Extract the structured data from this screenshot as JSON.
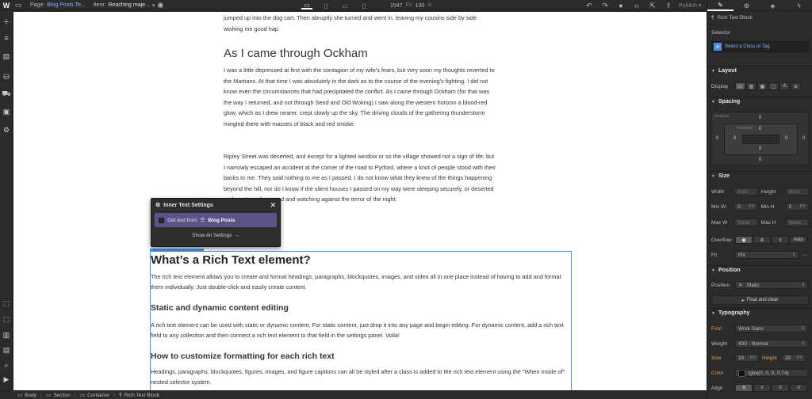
{
  "topbar": {
    "logo": "W",
    "page_label": "Page:",
    "page_value": "Blog Posts Te...",
    "item_label": "Item:",
    "item_value": "Reaching maje...",
    "canvas_width": "1547",
    "width_unit": "PX",
    "zoom": "100",
    "zoom_unit": "%",
    "publish_label": "Publish"
  },
  "article": {
    "p1": "jumped up into the dog cart.  Then abruptly she turned and went in, leaving my cousins side by side wishing me good hap.",
    "heading": "As I came through Ockham",
    "p2": "I was a little depressed at first with the contagion of my wife's fears, but very soon my thoughts reverted to the Martians.  At that time I was absolutely in the dark as to the course of the evening's fighting.  I did not know even the circumstances that had precipitated the conflict.  As I came through Ockham (for that was the way I returned, and not through Send and Old Woking) I saw along the western horizon a blood-red glow, which as I drew nearer, crept slowly up the sky.  The driving clouds of the gathering thunderstorm mingled there with masses of black and red smoke.",
    "p3": "Ripley Street was deserted, and except for a lighted window or so the village showed not a sign of life; but I narrowly escaped an accident at the corner of the road to Pyrford, where a knot of people stood with their backs to me.  They said nothing to me as I passed.  I do not know what they knew of the things happening beyond the hill, nor do I know if the silent houses I passed on my way were sleeping securely, or deserted and empty, or harassed and watching against the terror of the night."
  },
  "rich_text": {
    "h1": "What’s a Rich Text element?",
    "p1": "The rich text element allows you to create and format headings, paragraphs, blockquotes, images, and video all in one place instead of having to add and format them individually. Just double-click and easily create content.",
    "h2": "Static and dynamic content editing",
    "p2": "A rich text element can be used with static or dynamic content. For static content, just drop it into any page and begin editing. For dynamic content, add a rich text field to any collection and then connect a rich text element to that field in the settings panel. Voila!",
    "h3": "How to customize formatting for each rich text",
    "p3": "Headings, paragraphs, blockquotes, figures, images, and figure captions can all be styled after a class is added to the rich text element using the \"When inside of\" nested selector system."
  },
  "popup": {
    "title": "Inner Text Settings",
    "get_text_label": "Get text from",
    "collection": "Blog Posts",
    "show_all": "Show All Settings"
  },
  "breadcrumbs": [
    "Body",
    "Section",
    "Container",
    "Rich Text Block"
  ],
  "panel": {
    "element_name": "Rich Text Block",
    "selector_label": "Selector",
    "selector_placeholder": "Select a Class or Tag",
    "layout_title": "Layout",
    "display_label": "Display",
    "spacing_title": "Spacing",
    "margin_label": "MARGIN",
    "padding_label": "PADDING",
    "zero": "0",
    "size_title": "Size",
    "width_label": "Width",
    "height_label": "Height",
    "minw_label": "Min W",
    "minh_label": "Min H",
    "maxw_label": "Max W",
    "maxh_label": "Max H",
    "auto": "Auto",
    "none": "None",
    "px": "PX",
    "overflow_label": "Overflow",
    "fit_label": "Fit",
    "fit_value": "Fill",
    "position_title": "Position",
    "position_label": "Position",
    "position_value": "Static",
    "float_label": "Float and clear",
    "typography_title": "Typography",
    "font_label": "Font",
    "font_value": "Work Sans",
    "weight_label": "Weight",
    "weight_value": "400 - Normal",
    "size_label": "Size",
    "size_value": "16",
    "lineheight_label": "Height",
    "lineheight_value": "20",
    "color_label": "Color",
    "color_value": "rgba(0, 0, 0, 0.74)",
    "align_label": "Align"
  },
  "colors": {
    "accent": "#4a90e2",
    "popup_collection": "#5a5488",
    "label_orange": "#e8a05a"
  }
}
